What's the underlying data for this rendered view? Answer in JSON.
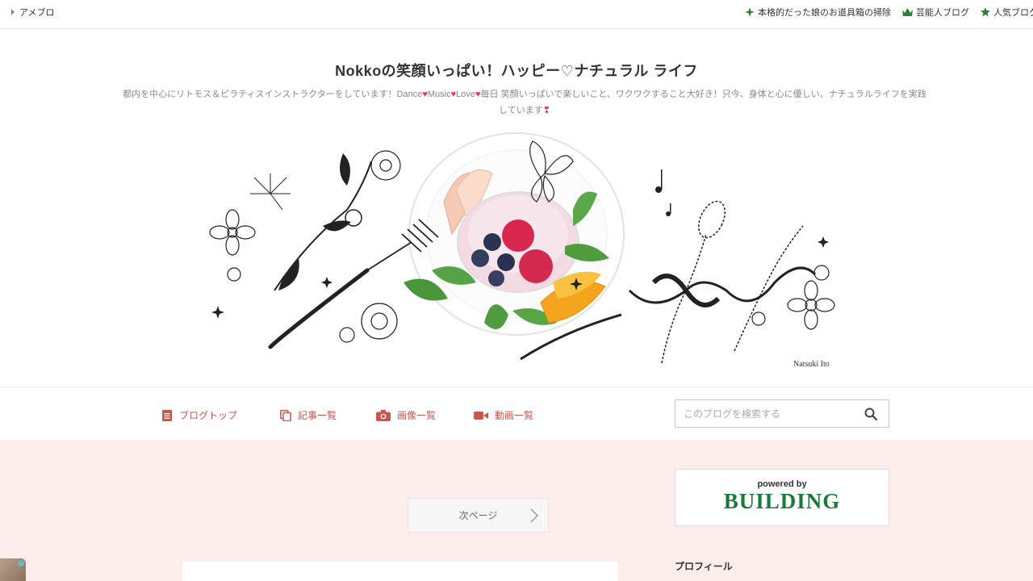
{
  "topbar": {
    "brand": "アメブロ",
    "links": [
      {
        "icon": "sparkle-icon",
        "label": "本格的だった娘のお道具箱の掃除"
      },
      {
        "icon": "crown-icon",
        "label": "芸能人ブログ"
      },
      {
        "icon": "star-icon",
        "label": "人気ブログ"
      }
    ]
  },
  "header": {
    "title": "Nokkoの笑顔いっぱい！ハッピー♡ナチュラル ライフ",
    "description_parts": [
      "都内を中心にリトモス＆ピラティスインストラクターをしています！Dance",
      "Music",
      "Love",
      "毎日 笑顔いっぱいで楽しいこと、ワクワクすること大好き！只今、身体と心に優しい、ナチュラルライフを実践しています"
    ],
    "signature": "Natsuki Ito"
  },
  "nav": {
    "items": [
      {
        "icon": "document-icon",
        "label": "ブログトップ"
      },
      {
        "icon": "copy-icon",
        "label": "記事一覧"
      },
      {
        "icon": "camera-icon",
        "label": "画像一覧"
      },
      {
        "icon": "video-icon",
        "label": "動画一覧"
      }
    ],
    "search_placeholder": "このブログを検索する"
  },
  "main": {
    "next_page": "次ページ",
    "building_powered": "powered by",
    "building_name": "BUILDING",
    "profile_heading": "プロフィール"
  },
  "colors": {
    "accent": "#c9574d",
    "brand_green": "#2f7d32",
    "main_bg": "#fdeeec",
    "heart": "#e8336d"
  }
}
